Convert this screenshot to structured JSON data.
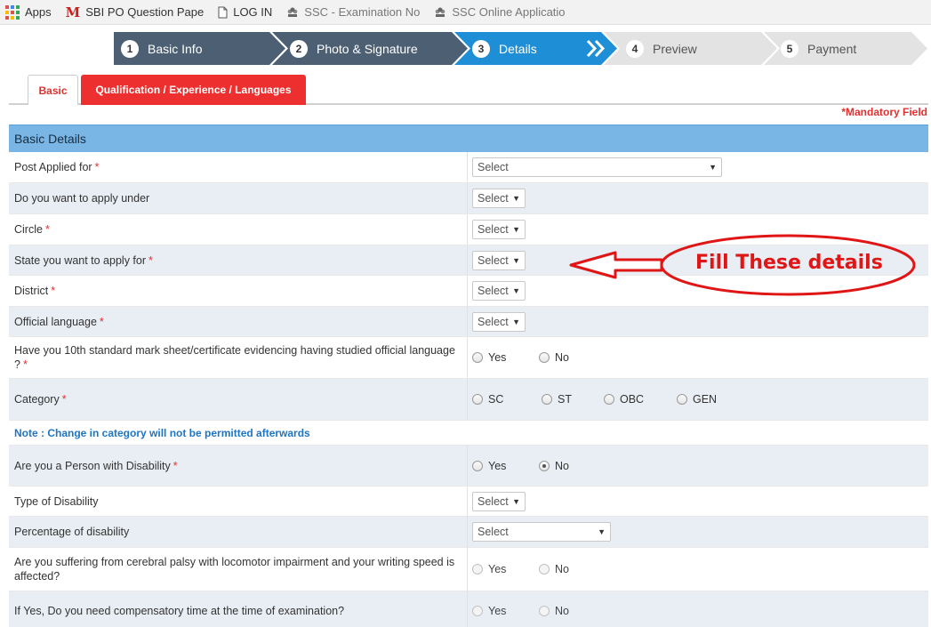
{
  "bookmarks": [
    {
      "icon": "apps-icon",
      "label": "Apps"
    },
    {
      "icon": "gmail-icon",
      "label": "SBI PO Question Pape"
    },
    {
      "icon": "page-icon",
      "label": "LOG IN"
    },
    {
      "icon": "emblem-icon",
      "label": "SSC - Examination No"
    },
    {
      "icon": "emblem-icon",
      "label": "SSC Online Applicatio"
    }
  ],
  "steps": [
    {
      "num": "1",
      "label": "Basic Info",
      "state": "done"
    },
    {
      "num": "2",
      "label": "Photo & Signature",
      "state": "done"
    },
    {
      "num": "3",
      "label": "Details",
      "state": "active"
    },
    {
      "num": "4",
      "label": "Preview",
      "state": "pending"
    },
    {
      "num": "5",
      "label": "Payment",
      "state": "pending"
    }
  ],
  "tabs": {
    "basic": "Basic",
    "qualification": "Qualification / Experience / Languages"
  },
  "mandatory_note": "*Mandatory Field",
  "section_title": "Basic Details",
  "fields": {
    "post": {
      "label": "Post Applied for",
      "required": "*",
      "value": "Select"
    },
    "apply_under": {
      "label": "Do you want to apply under",
      "value": "Select"
    },
    "circle": {
      "label": "Circle",
      "required": "*",
      "value": "Select"
    },
    "state": {
      "label": "State you want to apply for",
      "required": "*",
      "value": "Select"
    },
    "district": {
      "label": "District",
      "required": "*",
      "value": "Select"
    },
    "official_language": {
      "label": "Official language",
      "required": "*",
      "value": "Select"
    },
    "tenth_std": {
      "label": "Have you 10th standard mark sheet/certificate evidencing having studied official language ?",
      "required": "*",
      "yes": "Yes",
      "no": "No"
    },
    "category": {
      "label": "Category",
      "required": "*",
      "options": [
        "SC",
        "ST",
        "OBC",
        "GEN"
      ]
    },
    "category_note": "Note : Change in category will not be permitted afterwards",
    "pwd": {
      "label": "Are you a Person with Disability",
      "required": "*",
      "yes": "Yes",
      "no": "No",
      "selected": "No"
    },
    "disability_type": {
      "label": "Type of Disability",
      "value": "Select"
    },
    "disability_percent": {
      "label": "Percentage of disability",
      "value": "Select"
    },
    "cerebral_palsy": {
      "label": "Are you suffering from cerebral palsy with locomotor impairment and your writing speed is affected?",
      "yes": "Yes",
      "no": "No"
    },
    "compensatory_time": {
      "label": "If Yes, Do you need compensatory time at the time of examination?",
      "yes": "Yes",
      "no": "No"
    }
  },
  "annotation": {
    "text": "Fill These details",
    "color": "#e01616"
  },
  "colors": {
    "step_done": "#4d5f73",
    "step_active": "#1e8fd6",
    "step_pending": "#e3e3e3",
    "tab_active": "#ee2f2f",
    "section_header": "#79b6e6",
    "required": "#e03030",
    "note": "#1f75c4"
  }
}
